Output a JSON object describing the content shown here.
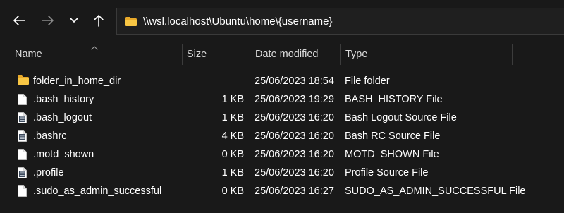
{
  "toolbar": {
    "back_icon": "arrow-left-icon",
    "forward_icon": "arrow-right-icon",
    "recent_icon": "chevron-down-icon",
    "up_icon": "arrow-up-icon"
  },
  "address": {
    "icon": "folder-icon",
    "path": "\\\\wsl.localhost\\Ubuntu\\home\\{username}"
  },
  "columns": {
    "name": "Name",
    "size": "Size",
    "date": "Date modified",
    "type": "Type"
  },
  "files": [
    {
      "name": "folder_in_home_dir",
      "size": "",
      "date": "25/06/2023 18:54",
      "type": "File folder",
      "icon": "folder-icon"
    },
    {
      "name": ".bash_history",
      "size": "1 KB",
      "date": "25/06/2023 19:29",
      "type": "BASH_HISTORY File",
      "icon": "file-icon"
    },
    {
      "name": ".bash_logout",
      "size": "1 KB",
      "date": "25/06/2023 16:20",
      "type": "Bash Logout Source File",
      "icon": "source-file-icon"
    },
    {
      "name": ".bashrc",
      "size": "4 KB",
      "date": "25/06/2023 16:20",
      "type": "Bash RC Source File",
      "icon": "source-file-icon"
    },
    {
      "name": ".motd_shown",
      "size": "0 KB",
      "date": "25/06/2023 16:20",
      "type": "MOTD_SHOWN File",
      "icon": "file-icon"
    },
    {
      "name": ".profile",
      "size": "1 KB",
      "date": "25/06/2023 16:20",
      "type": "Profile Source File",
      "icon": "source-file-icon"
    },
    {
      "name": ".sudo_as_admin_successful",
      "size": "0 KB",
      "date": "25/06/2023 16:27",
      "type": "SUDO_AS_ADMIN_SUCCESSFUL File",
      "icon": "file-icon"
    }
  ],
  "colors": {
    "background": "#191919",
    "folder": "#f8c644",
    "text": "#ffffff"
  }
}
